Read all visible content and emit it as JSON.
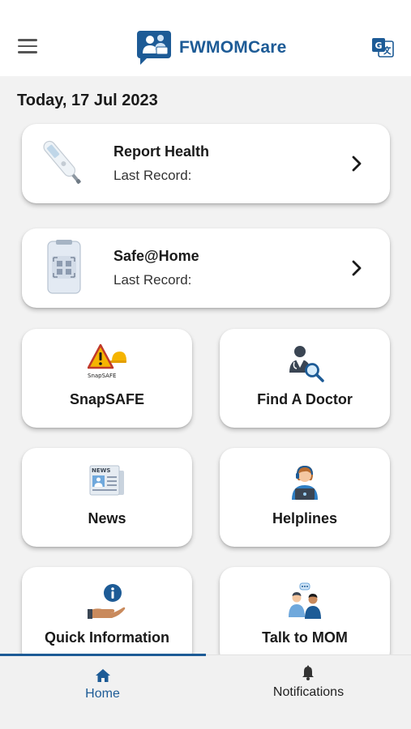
{
  "header": {
    "title": "FWMOMCare",
    "menu_icon": "hamburger-menu-icon",
    "translate_icon": "google-translate-icon"
  },
  "date_label": "Today, 17 Jul 2023",
  "cards": [
    {
      "title": "Report Health",
      "subtitle": "Last Record:",
      "icon": "thermometer-icon"
    },
    {
      "title": "Safe@Home",
      "subtitle": "Last Record:",
      "icon": "safe-home-device-icon"
    }
  ],
  "tiles": [
    {
      "label": "SnapSAFE",
      "icon": "snapsafe-warning-icon",
      "icon_text": "SnapSAFE"
    },
    {
      "label": "Find A Doctor",
      "icon": "doctor-search-icon"
    },
    {
      "label": "News",
      "icon": "newspaper-icon",
      "icon_text": "NEWS"
    },
    {
      "label": "Helplines",
      "icon": "helpline-agent-icon"
    },
    {
      "label": "Quick Information",
      "icon": "info-hand-icon"
    },
    {
      "label": "Talk to MOM",
      "icon": "conversation-icon"
    }
  ],
  "bottom_nav": [
    {
      "label": "Home",
      "icon": "home-icon",
      "active": true
    },
    {
      "label": "Notifications",
      "icon": "bell-icon",
      "active": false
    }
  ],
  "colors": {
    "brand": "#1d5b96",
    "background": "#f2f2f2",
    "card": "#ffffff",
    "warning": "#f5b400"
  }
}
